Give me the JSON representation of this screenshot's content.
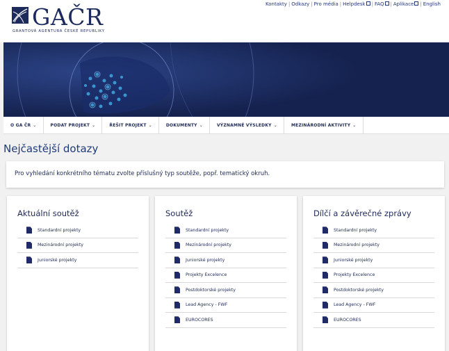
{
  "logo": {
    "name": "GAČR",
    "subtitle": "GRANTOVÁ AGENTURA ČESKÉ REPUBLIKY"
  },
  "top_links": [
    {
      "label": "Kontakty",
      "external": false
    },
    {
      "label": "Odkazy",
      "external": false
    },
    {
      "label": "Pro média",
      "external": false
    },
    {
      "label": "Helpdesk",
      "external": true
    },
    {
      "label": "FAQ",
      "external": true
    },
    {
      "label": "Aplikace",
      "external": true
    },
    {
      "label": "English",
      "external": false
    }
  ],
  "nav": [
    {
      "label": "O GA ČR"
    },
    {
      "label": "PODAT PROJEKT"
    },
    {
      "label": "ŘEŠIT PROJEKT"
    },
    {
      "label": "DOKUMENTY"
    },
    {
      "label": "VÝZNAMNÉ VÝSLEDKY"
    },
    {
      "label": "MEZINÁRODNÍ AKTIVITY"
    }
  ],
  "page_title": "Nejčastější dotazy",
  "info_text": "Pro vyhledání konkrétního tématu zvolte příslušný typ soutěže, popř. tematický okruh.",
  "cards": [
    {
      "title": "Aktuální soutěž",
      "items": [
        "Standardní projekty",
        "Mezinárodní projekty",
        "Juniorské projekty"
      ]
    },
    {
      "title": "Soutěž",
      "items": [
        "Standardní projekty",
        "Mezinárodní projekty",
        "Juniorské projekty",
        "Projekty Excelence",
        "Postdoktorské projekty",
        "Lead Agency - FWF",
        "EUROCORES"
      ]
    },
    {
      "title": "Dílčí a závěrečné zprávy",
      "items": [
        "Standardní projekty",
        "Mezinárodní projekty",
        "Juniorské projekty",
        "Projekty Excelence",
        "Postdoktorské projekty",
        "Lead Agency - FWF",
        "EUROCORES"
      ]
    }
  ],
  "colors": {
    "brand": "#1c2a5c",
    "hero_background": "#162657",
    "page_background": "#f1f1f1"
  }
}
